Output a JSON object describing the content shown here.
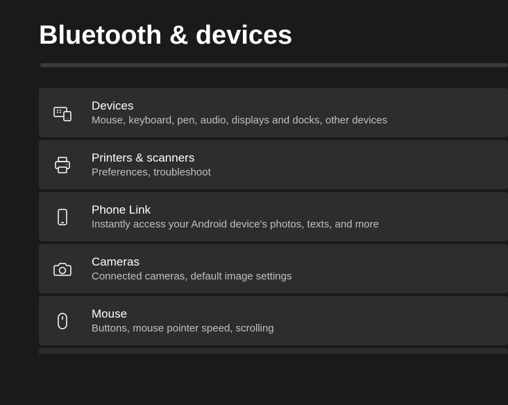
{
  "page": {
    "title": "Bluetooth & devices"
  },
  "items": [
    {
      "icon": "devices-icon",
      "title": "Devices",
      "subtitle": "Mouse, keyboard, pen, audio, displays and docks, other devices"
    },
    {
      "icon": "printer-icon",
      "title": "Printers & scanners",
      "subtitle": "Preferences, troubleshoot"
    },
    {
      "icon": "phone-icon",
      "title": "Phone Link",
      "subtitle": "Instantly access your Android device's photos, texts, and more"
    },
    {
      "icon": "camera-icon",
      "title": "Cameras",
      "subtitle": "Connected cameras, default image settings"
    },
    {
      "icon": "mouse-icon",
      "title": "Mouse",
      "subtitle": "Buttons, mouse pointer speed, scrolling"
    }
  ]
}
